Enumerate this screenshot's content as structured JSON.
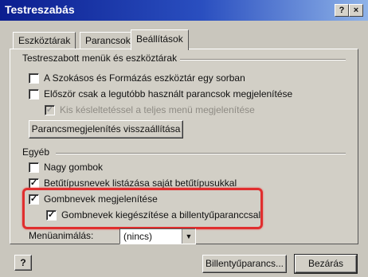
{
  "window": {
    "title": "Testreszabás",
    "help_button": "?",
    "close_button": "×"
  },
  "tabs": [
    {
      "label": "Eszköztárak",
      "active": false
    },
    {
      "label": "Parancsok",
      "active": false
    },
    {
      "label": "Beállítások",
      "active": true
    }
  ],
  "menus_group": {
    "title": "Testreszabott menük és eszköztárak",
    "options": [
      {
        "label": "A Szokásos és Formázás eszköztár egy sorban",
        "checked": false,
        "enabled": true
      },
      {
        "label": "Először csak a legutóbb használt parancsok megjelenítése",
        "checked": false,
        "enabled": true
      },
      {
        "label": "Kis késleltetéssel a teljes menü megjelenítése",
        "checked": true,
        "enabled": false
      }
    ],
    "reset_button": "Parancsmegjelenítés visszaállítása"
  },
  "other_group": {
    "title": "Egyéb",
    "options": [
      {
        "label": "Nagy gombok",
        "checked": false
      },
      {
        "label": "Betűtípusnevek listázása saját betűtípusukkal",
        "checked": true
      },
      {
        "label": "Gombnevek megjelenítése",
        "checked": true
      },
      {
        "label": "Gombnevek kiegészítése a billentyűparanccsal",
        "checked": true
      }
    ],
    "menu_animation_label": "Menüanimálás:",
    "menu_animation_value": "(nincs)"
  },
  "footer": {
    "help_icon": "?",
    "keyboard_button": "Billentyűparancs...",
    "close_button": "Bezárás"
  },
  "colors": {
    "titlebar_start": "#0b1e8f",
    "highlight": "#e02e2e"
  }
}
